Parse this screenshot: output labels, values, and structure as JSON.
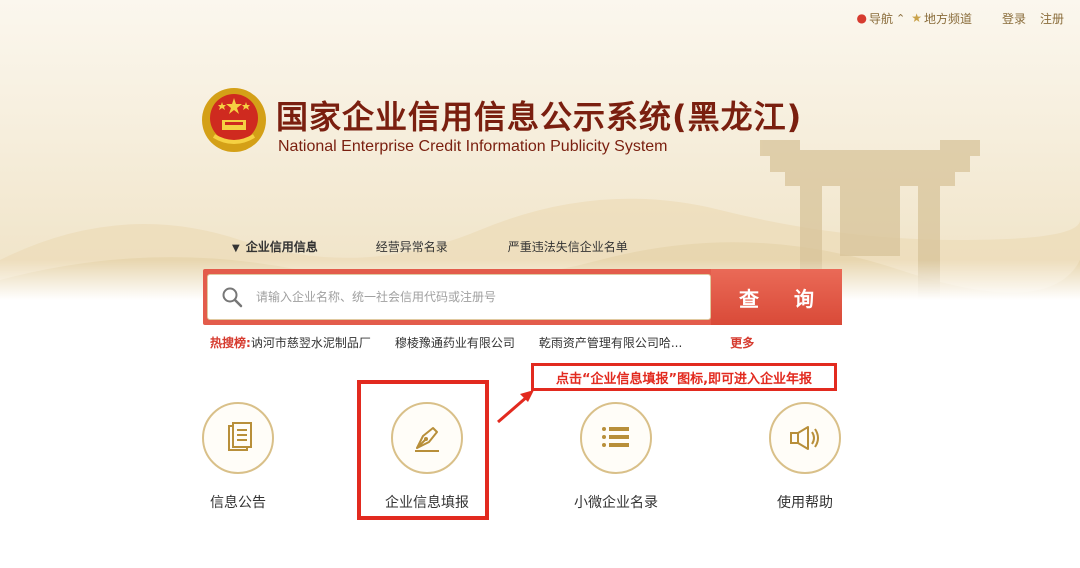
{
  "topbar": {
    "nav_label": "导航",
    "nav_caret": "⌃",
    "local_label": "地方频道",
    "login_label": "登录",
    "register_label": "注册"
  },
  "header": {
    "title_cn": "国家企业信用信息公示系统(黑龙江)",
    "title_en": "National Enterprise Credit Information Publicity System"
  },
  "tabs": [
    {
      "label": "企业信用信息",
      "active": true
    },
    {
      "label": "经营异常名录",
      "active": false
    },
    {
      "label": "严重违法失信企业名单",
      "active": false
    }
  ],
  "search": {
    "placeholder": "请输入企业名称、统一社会信用代码或注册号",
    "button_label": "查 询"
  },
  "hot_search": {
    "label": "热搜榜:",
    "items": [
      "讷河市慈翌水泥制品厂",
      "穆棱豫通药业有限公司",
      "乾雨资产管理有限公司哈..."
    ],
    "more": "更多"
  },
  "callout": {
    "text": "点击“企业信息填报”图标,即可进入企业年报"
  },
  "features": [
    {
      "label": "信息公告",
      "icon": "document-icon"
    },
    {
      "label": "企业信息填报",
      "icon": "pen-nib-icon"
    },
    {
      "label": "小微企业名录",
      "icon": "list-icon"
    },
    {
      "label": "使用帮助",
      "icon": "megaphone-icon"
    }
  ],
  "colors": {
    "brand_red": "#e35c4b",
    "title_brown": "#7a1f0f",
    "gold": "#d9c089",
    "annotation_red": "#e22a1f"
  }
}
